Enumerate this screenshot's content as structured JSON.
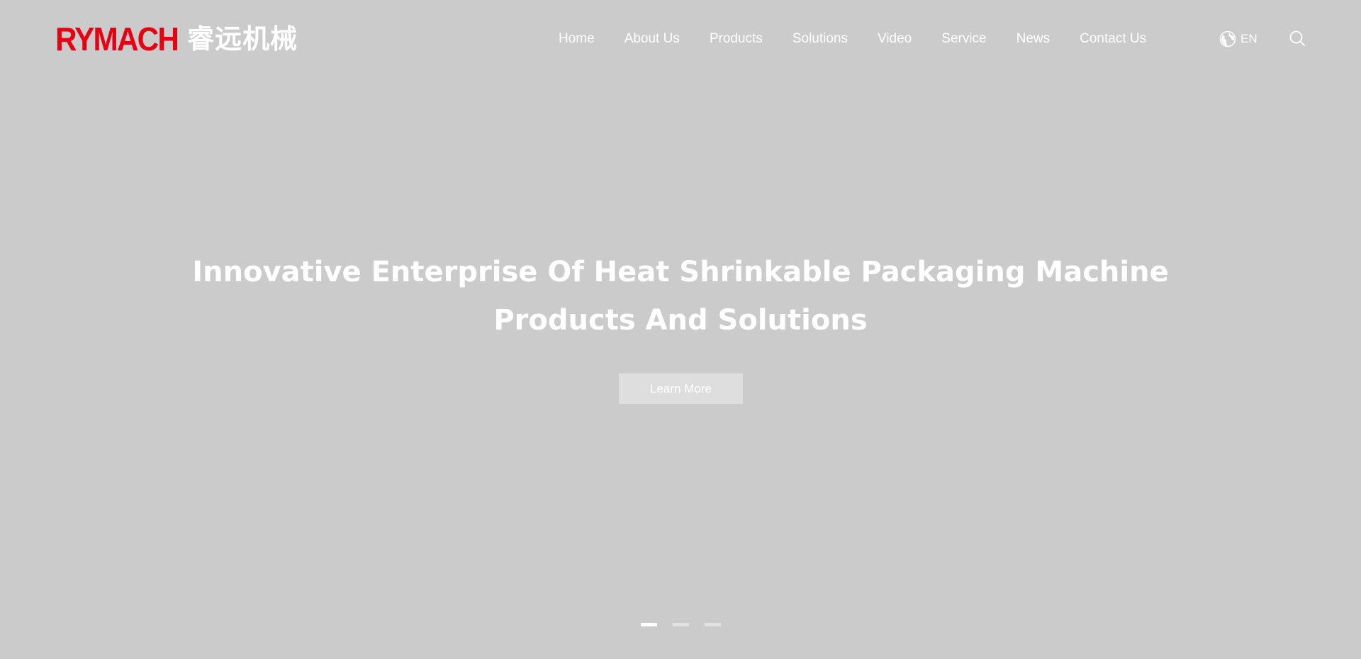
{
  "brand": {
    "name_en": "RYMACH",
    "name_cn": "睿远机械",
    "accent_color": "#e60012"
  },
  "nav": {
    "items": [
      {
        "label": "Home"
      },
      {
        "label": "About Us"
      },
      {
        "label": "Products"
      },
      {
        "label": "Solutions"
      },
      {
        "label": "Video"
      },
      {
        "label": "Service"
      },
      {
        "label": "News"
      },
      {
        "label": "Contact Us"
      }
    ],
    "language": {
      "label": "EN",
      "icon": "globe-icon"
    },
    "search": {
      "icon": "search-icon"
    }
  },
  "hero": {
    "title_line1": "Innovative Enterprise Of Heat Shrinkable Packaging Machine",
    "title_line2": "Products And Solutions",
    "cta_label": "Learn More",
    "background_color": "#cbcbcb"
  },
  "slider": {
    "total": 3,
    "active_index": 0
  }
}
